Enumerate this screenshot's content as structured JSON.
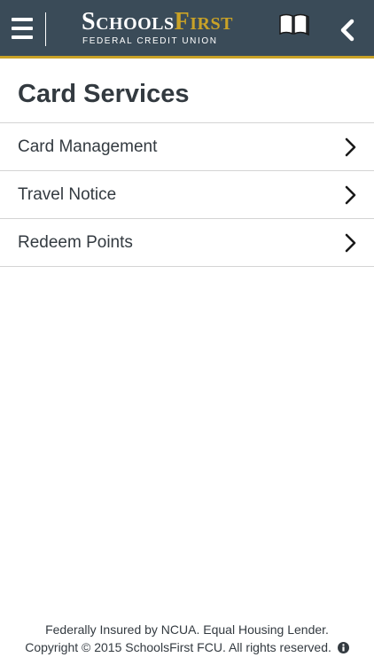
{
  "header": {
    "logo": {
      "name_part1": "Schools",
      "name_part2": "First",
      "subtitle": "FEDERAL CREDIT UNION"
    },
    "icons": {
      "menu": "hamburger-menu-icon",
      "book": "open-book-icon",
      "back": "chevron-left-icon"
    },
    "colors": {
      "background": "#3a4b58",
      "accent": "#c9a227"
    }
  },
  "page": {
    "title": "Card Services"
  },
  "menu_items": [
    {
      "label": "Card Management"
    },
    {
      "label": "Travel Notice"
    },
    {
      "label": "Redeem Points"
    }
  ],
  "footer": {
    "line1": "Federally Insured by NCUA. Equal Housing Lender.",
    "line2": "Copyright © 2015 SchoolsFirst FCU. All rights reserved."
  }
}
